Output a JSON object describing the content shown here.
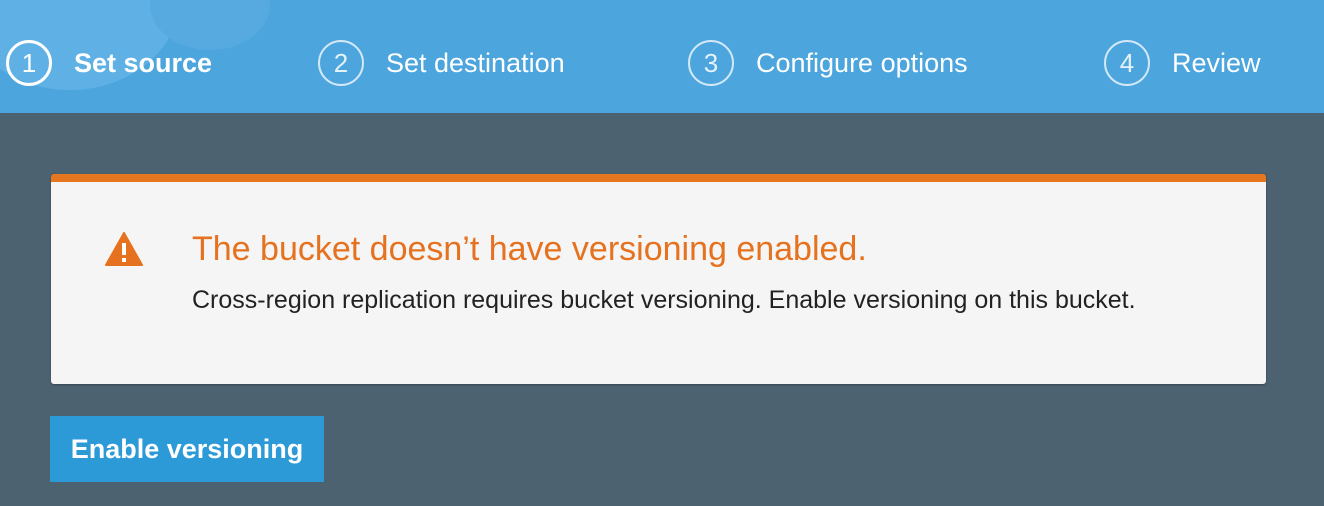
{
  "wizard": {
    "steps": [
      {
        "number": "1",
        "label": "Set source",
        "active": true
      },
      {
        "number": "2",
        "label": "Set destination",
        "active": false
      },
      {
        "number": "3",
        "label": "Configure options",
        "active": false
      },
      {
        "number": "4",
        "label": "Review",
        "active": false
      }
    ]
  },
  "alert": {
    "icon": "warning-icon",
    "title": "The bucket doesn’t have versioning enabled.",
    "message": "Cross-region replication requires bucket versioning. Enable versioning on this bucket.",
    "accent_color": "#e6771f"
  },
  "actions": {
    "enable_versioning_label": "Enable versioning"
  },
  "colors": {
    "header": "#4ca5dd",
    "background": "#4d6271",
    "button": "#2d9ad8"
  }
}
